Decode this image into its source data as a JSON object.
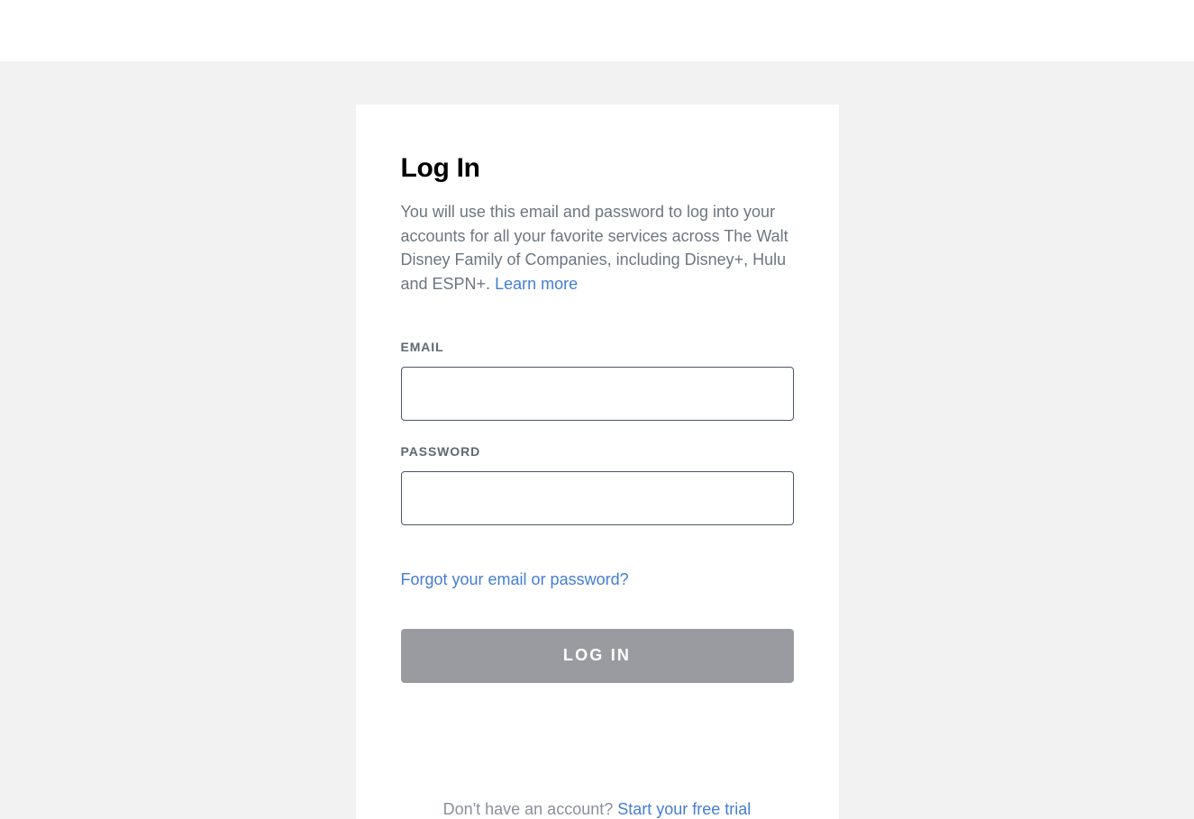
{
  "title": "Log In",
  "description_text": "You will use this email and password to log into your accounts for all your favorite services across The Walt Disney Family of Companies, including Disney+, Hulu and ESPN+. ",
  "learn_more": "Learn more",
  "fields": {
    "email_label": "EMAIL",
    "email_value": "",
    "password_label": "PASSWORD",
    "password_value": ""
  },
  "forgot_link": "Forgot your email or password?",
  "login_button": "LOG IN",
  "footer_prompt": "Don't have an account? ",
  "footer_cta": "Start your free trial"
}
